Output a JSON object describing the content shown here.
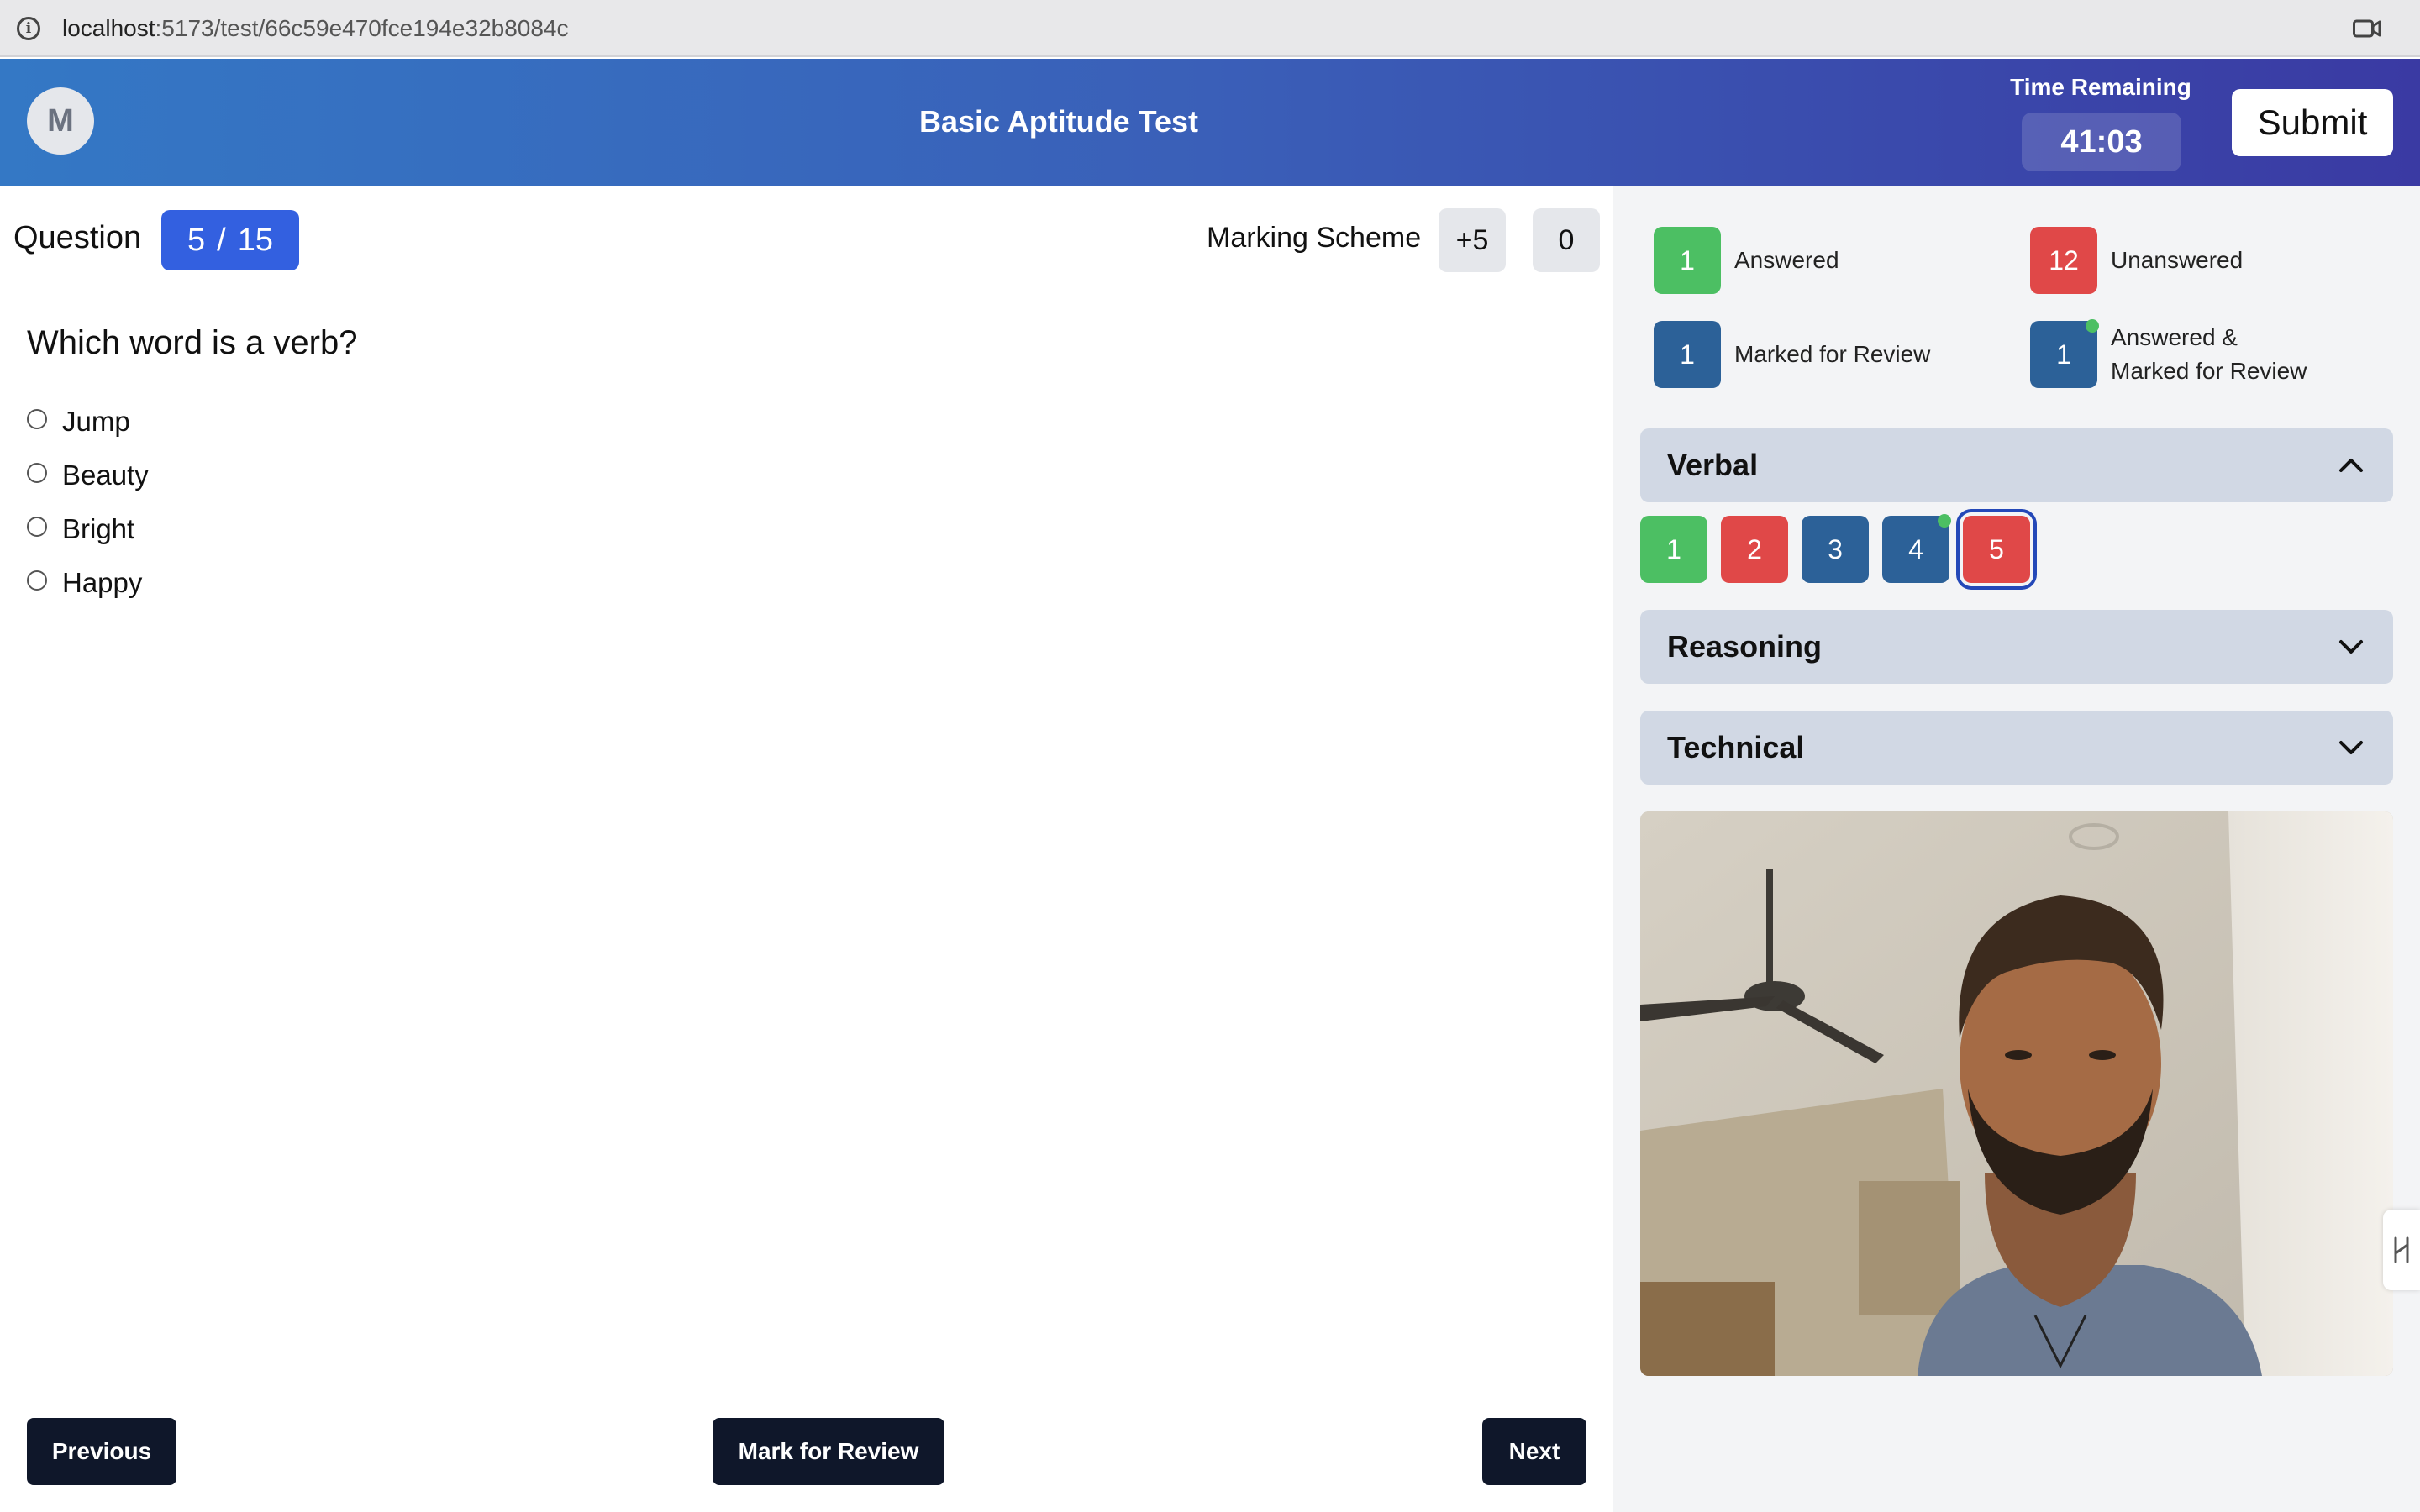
{
  "browser": {
    "url_host": "localhost",
    "url_path": ":5173/test/66c59e470fce194e32b8084c"
  },
  "header": {
    "avatar_initial": "M",
    "title": "Basic Aptitude Test",
    "time_label": "Time Remaining",
    "time_value": "41:03",
    "submit_label": "Submit"
  },
  "question": {
    "label": "Question",
    "current": "5",
    "separator": "/",
    "total": "15",
    "marking_label": "Marking Scheme",
    "marks_correct": "+5",
    "marks_wrong": "0",
    "text": "Which word is a verb?",
    "options": [
      "Jump",
      "Beauty",
      "Bright",
      "Happy"
    ],
    "selected_option": null
  },
  "nav": {
    "previous": "Previous",
    "mark_review": "Mark for Review",
    "next": "Next"
  },
  "legend": {
    "answered": {
      "count": "1",
      "label": "Answered",
      "color": "#4cbf63"
    },
    "unanswered": {
      "count": "12",
      "label": "Unanswered",
      "color": "#e04848"
    },
    "marked": {
      "count": "1",
      "label": "Marked for Review",
      "color": "#2c6198"
    },
    "answered_marked": {
      "count": "1",
      "label_line1": "Answered &",
      "label_line2": "Marked for Review",
      "color": "#2c6198"
    }
  },
  "sections": [
    {
      "name": "Verbal",
      "expanded": true,
      "questions": [
        {
          "number": "1",
          "status": "answered"
        },
        {
          "number": "2",
          "status": "unanswered"
        },
        {
          "number": "3",
          "status": "marked"
        },
        {
          "number": "4",
          "status": "answered_marked"
        },
        {
          "number": "5",
          "status": "unanswered",
          "current": true
        }
      ]
    },
    {
      "name": "Reasoning",
      "expanded": false
    },
    {
      "name": "Technical",
      "expanded": false
    }
  ],
  "icons": {
    "info": "info-icon",
    "camera": "camera-icon",
    "chevron_up": "chevron-up-icon",
    "chevron_down": "chevron-down-icon",
    "handle": "drag-handle-icon"
  }
}
